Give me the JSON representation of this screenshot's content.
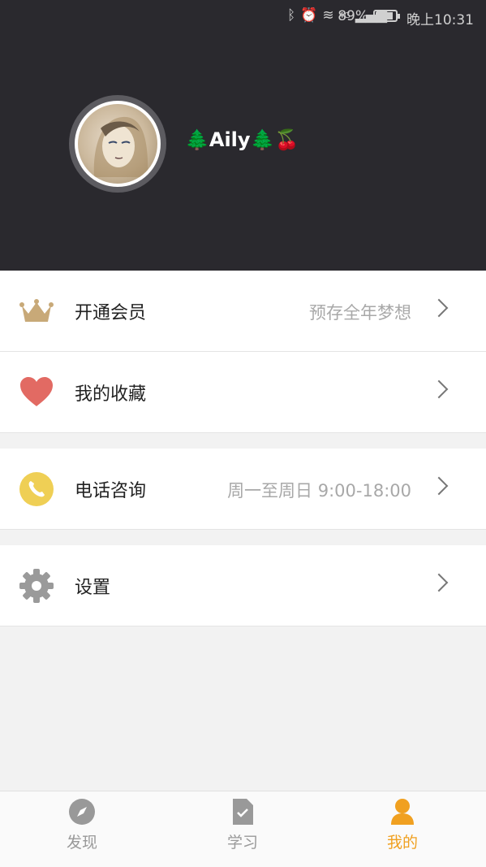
{
  "status_bar": {
    "battery": "89%",
    "time": "晚上10:31",
    "network": "4G"
  },
  "profile": {
    "username": "🌲Aily🌲🍒"
  },
  "menu": [
    {
      "label": "开通会员",
      "sub": "预存全年梦想",
      "icon": "crown-icon"
    },
    {
      "label": "我的收藏",
      "sub": "",
      "icon": "heart-icon"
    },
    {
      "label": "电话咨询",
      "sub": "周一至周日 9:00-18:00",
      "icon": "phone-icon"
    },
    {
      "label": "设置",
      "sub": "",
      "icon": "gear-icon"
    }
  ],
  "tabs": [
    {
      "label": "发现",
      "icon": "compass-icon",
      "active": false
    },
    {
      "label": "学习",
      "icon": "document-icon",
      "active": false
    },
    {
      "label": "我的",
      "icon": "person-icon",
      "active": true
    }
  ],
  "colors": {
    "header_bg": "#2a292e",
    "accent": "#f0a020",
    "crown": "#c8a978",
    "heart": "#e26a63",
    "phone": "#efcf55",
    "gear": "#9a9a9a"
  }
}
